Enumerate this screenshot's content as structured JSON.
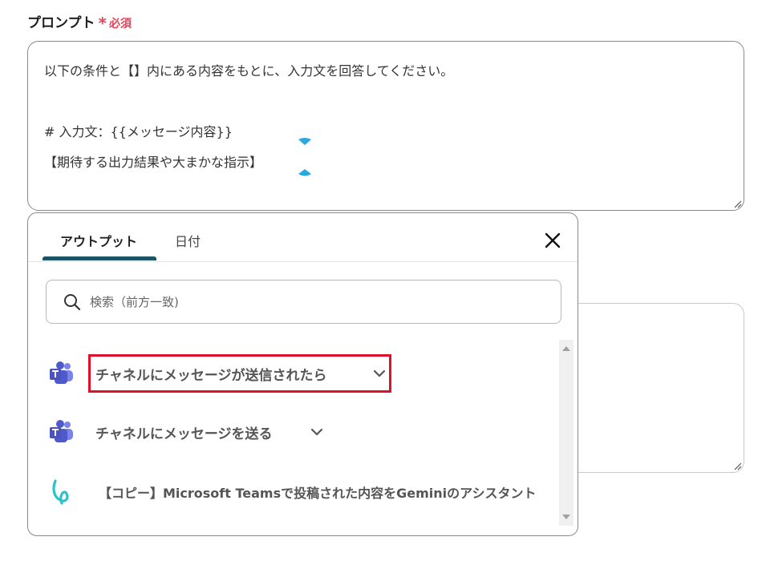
{
  "field": {
    "label": "プロンプト",
    "required_star": "*",
    "required_text": "必須"
  },
  "prompt": {
    "lines": [
      "以下の条件と【】内にある内容をもとに、入力文を回答してください。",
      "",
      "# 入力文：{{メッセージ内容}}",
      "【期待する出力結果や大まかな指示】"
    ]
  },
  "popup": {
    "tabs": [
      {
        "label": "アウトプット",
        "active": true
      },
      {
        "label": "日付",
        "active": false
      }
    ],
    "search": {
      "placeholder": "検索（前方一致)",
      "value": ""
    },
    "items": [
      {
        "label": "チャネルにメッセージが送信されたら",
        "icon": "microsoft-teams-icon",
        "expandable": true,
        "highlighted": true
      },
      {
        "label": "チャネルにメッセージを送る",
        "icon": "microsoft-teams-icon",
        "expandable": true,
        "highlighted": false
      },
      {
        "label": "【コピー】Microsoft Teamsで投稿された内容をGeminiのアシスタント",
        "icon": "gemini-logo-icon",
        "expandable": false,
        "highlighted": false
      }
    ]
  },
  "colors": {
    "required": "#e0455a",
    "tab_underline": "#1d5566",
    "highlight_border": "#e0102a",
    "teams_purple": "#5059c9"
  }
}
